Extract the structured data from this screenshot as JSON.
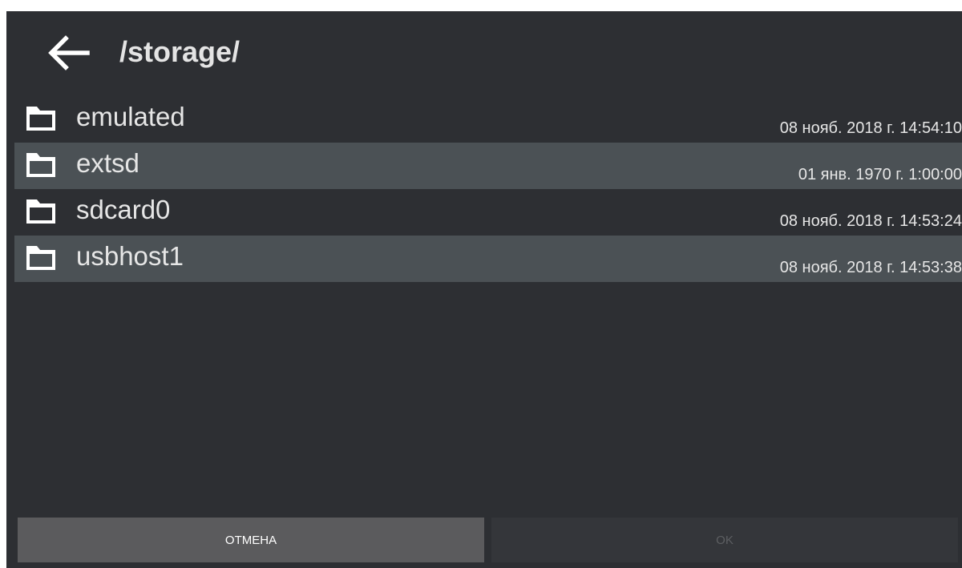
{
  "header": {
    "back_icon": "arrow-left-icon",
    "path": "/storage/"
  },
  "files": [
    {
      "name": "emulated",
      "date": "08 нояб. 2018 г. 14:54:10",
      "icon": "folder-icon"
    },
    {
      "name": "extsd",
      "date": "01 янв. 1970 г. 1:00:00",
      "icon": "folder-icon"
    },
    {
      "name": "sdcard0",
      "date": "08 нояб. 2018 г. 14:53:24",
      "icon": "folder-icon"
    },
    {
      "name": "usbhost1",
      "date": "08 нояб. 2018 г. 14:53:38",
      "icon": "folder-icon"
    }
  ],
  "buttons": {
    "cancel_label": "ОТМЕНА",
    "ok_label": "OK"
  },
  "colors": {
    "background": "#2d2f33",
    "row_highlight": "#4b5155",
    "cancel_button": "#5b5b5d",
    "ok_button_disabled": "#34363a",
    "text": "#e6e6e6"
  }
}
